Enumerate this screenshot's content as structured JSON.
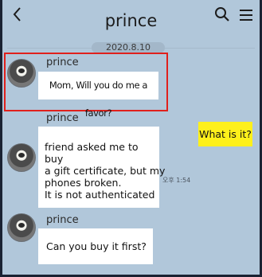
{
  "header": {
    "title": "prince",
    "back_icon": "chevron-left-icon",
    "search_icon": "search-icon",
    "menu_icon": "hamburger-menu-icon"
  },
  "date_divider": "2020.8.10",
  "messages": [
    {
      "sender": "prince",
      "text": "Mom, Will you do me a favor?",
      "highlighted": true
    },
    {
      "sender": "me",
      "text": "What is it?"
    },
    {
      "sender": "prince",
      "lines": [
        "friend asked me to buy",
        "a gift certificate, but my",
        "phones broken.",
        "It is not authenticated"
      ],
      "time": "오후 1:54"
    },
    {
      "sender": "prince",
      "text": "Can you buy it first?"
    }
  ],
  "colors": {
    "background": "#b1c7da",
    "incoming_bubble": "#ffffff",
    "outgoing_bubble": "#fef01b",
    "highlight": "#e0201c"
  }
}
